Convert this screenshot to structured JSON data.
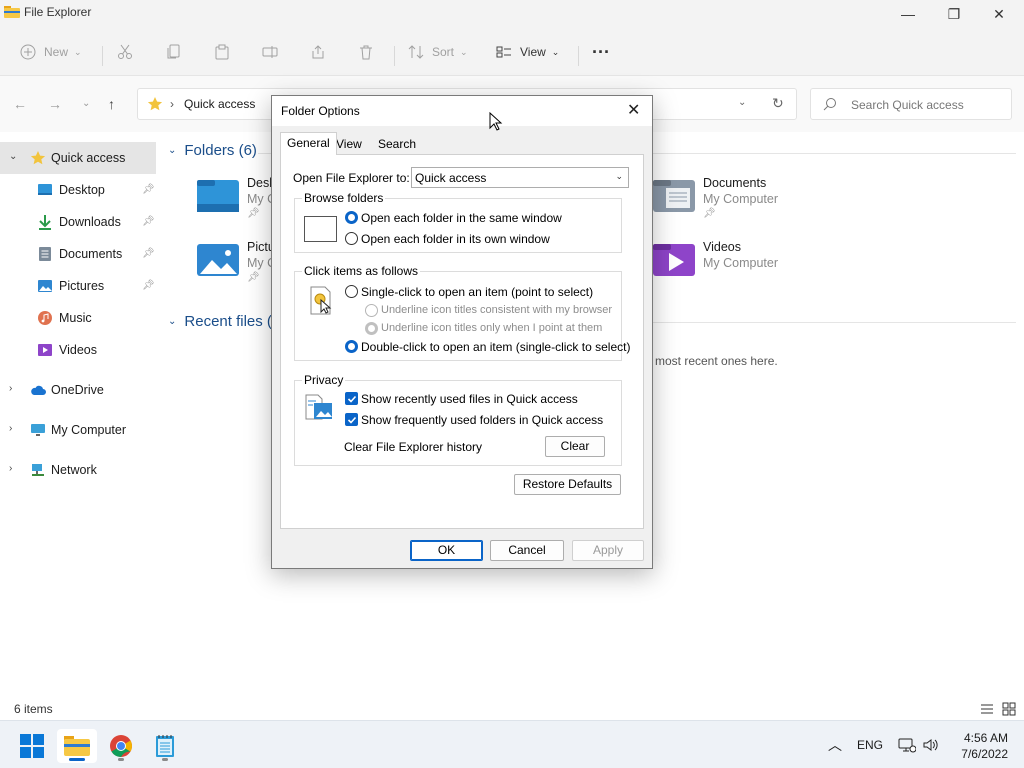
{
  "window": {
    "title": "File Explorer",
    "minimize_glyph": "—",
    "maximize_glyph": "❐",
    "close_glyph": "✕"
  },
  "toolbar": {
    "new_label": "New",
    "sort_label": "Sort",
    "view_label": "View",
    "more_glyph": "···"
  },
  "address": {
    "breadcrumb": "Quick access",
    "search_placeholder": "Search Quick access"
  },
  "sidebar": {
    "items": [
      {
        "label": "Quick access"
      },
      {
        "label": "Desktop"
      },
      {
        "label": "Downloads"
      },
      {
        "label": "Documents"
      },
      {
        "label": "Pictures"
      },
      {
        "label": "Music"
      },
      {
        "label": "Videos"
      },
      {
        "label": "OneDrive"
      },
      {
        "label": "My Computer"
      },
      {
        "label": "Network"
      }
    ]
  },
  "main": {
    "folders_header": "Folders (6)",
    "recent_header": "Recent files (0",
    "tiles": [
      {
        "name": "Desk",
        "sub": "My C"
      },
      {
        "name": "Pictu",
        "sub": "My C"
      },
      {
        "name": "Documents",
        "sub": "My Computer"
      },
      {
        "name": "Videos",
        "sub": "My Computer"
      }
    ],
    "empty_message": "most recent ones here."
  },
  "status": {
    "item_count": "6 items"
  },
  "dialog": {
    "title": "Folder Options",
    "tabs": [
      "General",
      "View",
      "Search"
    ],
    "open_label": "Open File Explorer to:",
    "open_value": "Quick access",
    "browse": {
      "legend": "Browse folders",
      "options": [
        "Open each folder in the same window",
        "Open each folder in its own window"
      ]
    },
    "click": {
      "legend": "Click items as follows",
      "single": "Single-click to open an item (point to select)",
      "underline_browser": "Underline icon titles consistent with my browser",
      "underline_point": "Underline icon titles only when I point at them",
      "double": "Double-click to open an item (single-click to select)"
    },
    "privacy": {
      "legend": "Privacy",
      "recent_files": "Show recently used files in Quick access",
      "frequent_folders": "Show frequently used folders in Quick access",
      "clear_history_label": "Clear File Explorer history",
      "clear_button": "Clear"
    },
    "restore_button": "Restore Defaults",
    "ok_button": "OK",
    "cancel_button": "Cancel",
    "apply_button": "Apply"
  },
  "taskbar": {
    "language": "ENG",
    "time": "4:56 AM",
    "date": "7/6/2022"
  },
  "colors": {
    "accent": "#0a64c8",
    "folder_yellow": "#f2c43d",
    "header_blue": "#1b4e8a"
  }
}
